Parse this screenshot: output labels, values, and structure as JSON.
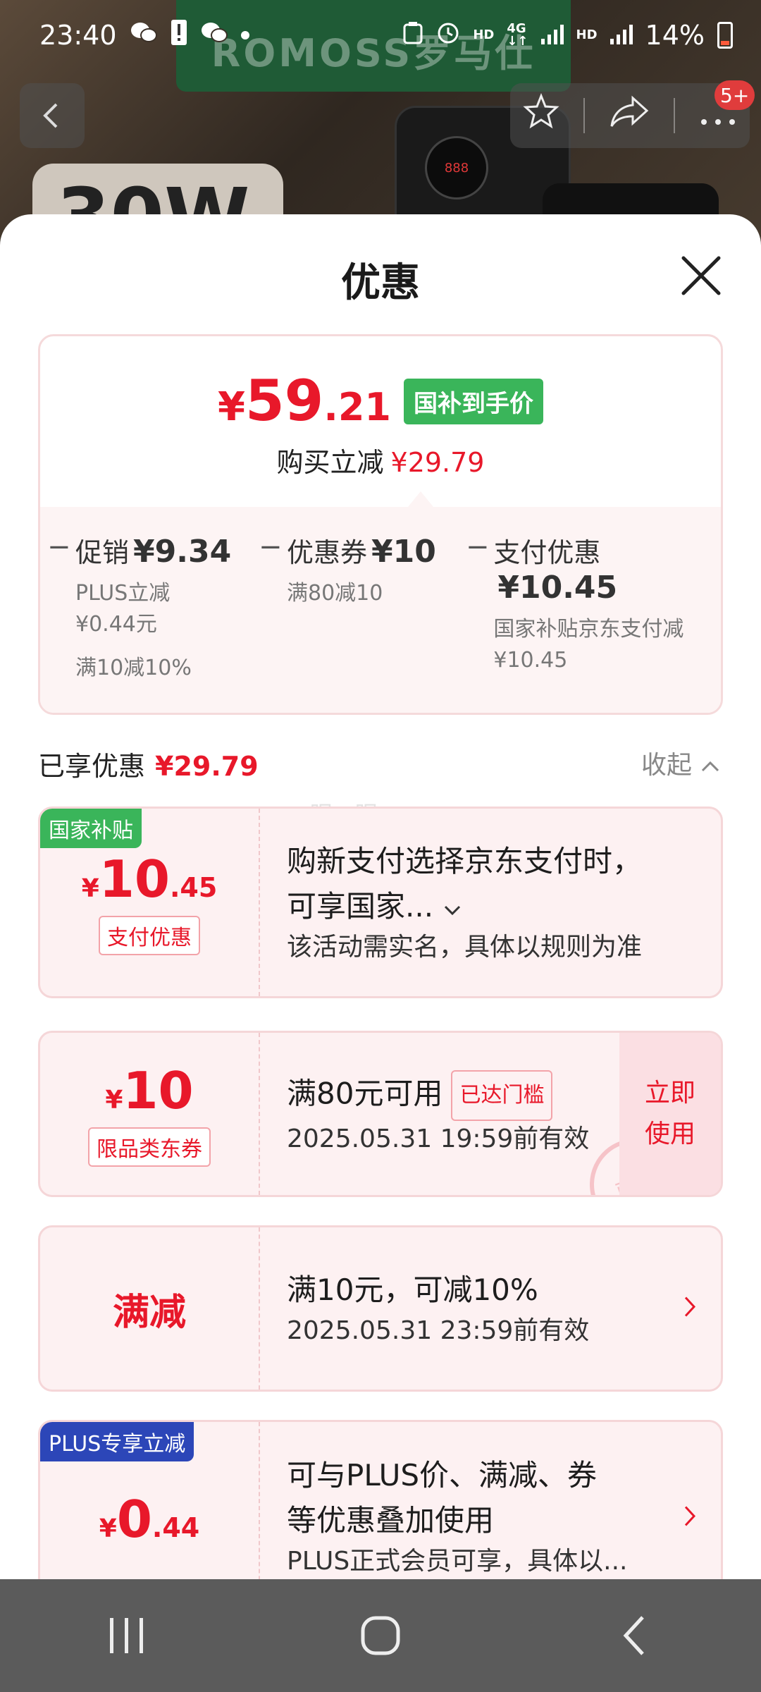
{
  "status": {
    "time": "23:40",
    "battery": "14%"
  },
  "background": {
    "brand": "ROMOSS罗马仕",
    "wattage": "30W"
  },
  "nav": {
    "back": "‹",
    "badge": "5+"
  },
  "sheet": {
    "title": "优惠"
  },
  "summary": {
    "price_symbol": "¥",
    "price_int": "59",
    "price_dec": ".21",
    "price_tag": "国补到手价",
    "reduce_label": "购买立减",
    "reduce_amount": "¥29.79",
    "breakdown": [
      {
        "label": "促销",
        "amount": "¥9.34",
        "sub1": "PLUS立减",
        "sub2": "¥0.44元",
        "sub3": "满10减10%"
      },
      {
        "label": "优惠券",
        "amount": "¥10",
        "sub1": "满80减10"
      },
      {
        "label": "支付优惠",
        "amount": "¥10.45",
        "sub1": "国家补贴京东支付减",
        "sub2": "¥10.45"
      }
    ]
  },
  "enjoyed": {
    "label": "已享优惠",
    "amount": "¥29.79",
    "collapse": "收起"
  },
  "watermark": "眠一眠",
  "coupons": [
    {
      "corner_tag": "国家补贴",
      "symbol": "¥",
      "int": "10",
      "dec": ".45",
      "badge": "支付优惠",
      "title1": "购新支付选择京东支付时，",
      "title2": "可享国家...",
      "desc": "该活动需实名，具体以规则为准"
    },
    {
      "symbol": "¥",
      "int": "10",
      "badge": "限品类东券",
      "title": "满80元可用",
      "reached": "已达门槛",
      "desc": "2025.05.31 19:59前有效",
      "use_now_1": "立即",
      "use_now_2": "使用",
      "stamp": "已领"
    },
    {
      "label": "满减",
      "title": "满10元，可减10%",
      "desc": "2025.05.31 23:59前有效"
    },
    {
      "corner_tag": "PLUS专享立减",
      "symbol": "¥",
      "int": "0",
      "dec": ".44",
      "title1": "可与PLUS价、满减、券",
      "title2": "等优惠叠加使用",
      "desc": "PLUS正式会员可享，具体以..."
    }
  ],
  "colors": {
    "accent": "#e8182a",
    "green_tag": "#3ab55a",
    "plus_tag": "#2c46b8"
  }
}
